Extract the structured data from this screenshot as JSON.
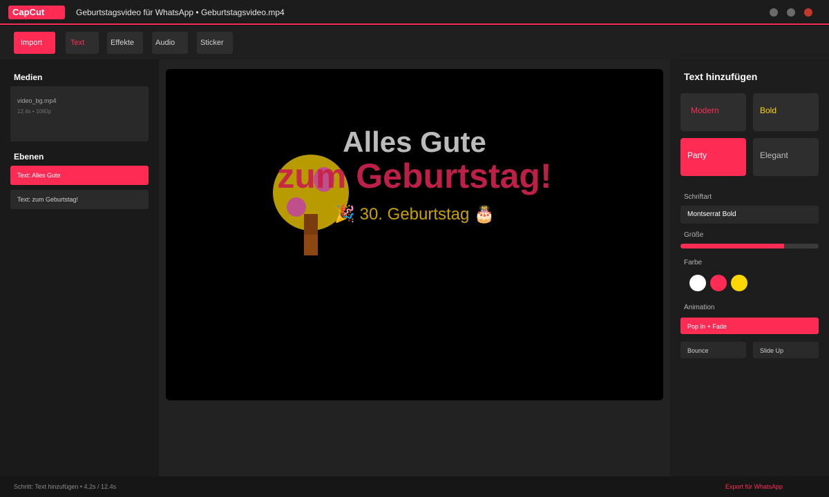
{
  "app": {
    "logo": "CapCut",
    "title": "Geburtstagsvideo für WhatsApp • Geburtstagsvideo.mp4"
  },
  "toolbar": {
    "import": "Import",
    "text": "Text",
    "effekte": "Effekte",
    "audio": "Audio",
    "sticker": "Sticker"
  },
  "left_panel": {
    "media_title": "Medien",
    "media": {
      "name": "video_bg.mp4",
      "meta": "12.4s • 1080p"
    },
    "layers_title": "Ebenen",
    "layers": [
      {
        "label": "Text: Alles Gute",
        "selected": true
      },
      {
        "label": "Text: zum Geburtstag!",
        "selected": false
      }
    ]
  },
  "canvas": {
    "line1": "Alles Gute",
    "line2": "zum Geburtstag!",
    "line3": "🎉 30. Geburtstag 🎂"
  },
  "right_panel": {
    "title": "Text hinzufügen",
    "styles": [
      "Modern",
      "Bold",
      "Party",
      "Elegant"
    ],
    "selected_style": "Party",
    "font_label": "Schriftart",
    "font_value": "Montserrat Bold",
    "size_label": "Größe",
    "size_level": 0.75,
    "color_label": "Farbe",
    "colors": [
      "#ffffff",
      "#fe2c55",
      "#ffd700"
    ],
    "animation_label": "Animation",
    "animation_selected": "Pop In + Fade",
    "animation_options": [
      "Bounce",
      "Slide Up"
    ]
  },
  "status": {
    "text": "Schritt: Text hinzufügen • 4.2s / 12.4s",
    "export": "Export für WhatsApp"
  },
  "colors": {
    "accent": "#fe2c55",
    "gold": "#ffd700"
  }
}
